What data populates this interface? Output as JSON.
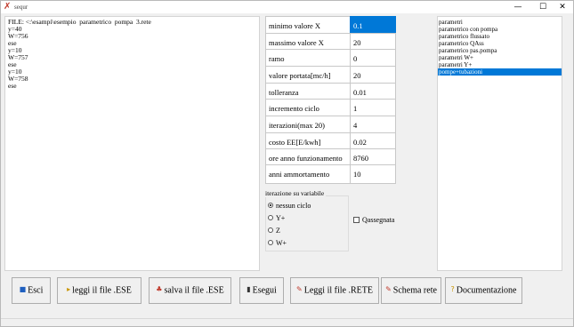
{
  "window": {
    "title": "sequr",
    "minimize_glyph": "—",
    "maximize_glyph": "☐",
    "close_glyph": "✕"
  },
  "output": {
    "lines": [
      "FILE: <:\\esampi\\esempio  parametrico  pompa  3.rete",
      "y=40",
      "W=756",
      "ese",
      "y=10",
      "W=757",
      "ese",
      "y=10",
      "W=758",
      "ese"
    ]
  },
  "params": [
    {
      "label": "minimo valore X",
      "value": "0.1",
      "selected": true
    },
    {
      "label": "massimo valore X",
      "value": "20",
      "selected": false
    },
    {
      "label": "ramo",
      "value": "0",
      "selected": false
    },
    {
      "label": "valore portata[mc/h]",
      "value": "20",
      "selected": false
    },
    {
      "label": "tolleranza",
      "value": "0.01",
      "selected": false
    },
    {
      "label": "incremento ciclo",
      "value": "1",
      "selected": false
    },
    {
      "label": "iterazioni(max 20)",
      "value": "4",
      "selected": false
    },
    {
      "label": "costo EE[E/kwh]",
      "value": "0.02",
      "selected": false
    },
    {
      "label": "ore anno funzionamento",
      "value": "8760",
      "selected": false
    },
    {
      "label": "anni ammortamento",
      "value": "10",
      "selected": false
    }
  ],
  "iteration_group": {
    "legend": "iterazione su variabile",
    "options": [
      {
        "label": "nessun ciclo",
        "checked": true
      },
      {
        "label": "Y+",
        "checked": false
      },
      {
        "label": "Z",
        "checked": false
      },
      {
        "label": "W+",
        "checked": false
      }
    ]
  },
  "checkbox": {
    "label": "Qassegnata",
    "checked": false
  },
  "list": {
    "items": [
      {
        "label": "parametri",
        "selected": false
      },
      {
        "label": "parametrico con pompa",
        "selected": false
      },
      {
        "label": "parametrico flussato",
        "selected": false
      },
      {
        "label": "parametrico QAss",
        "selected": false
      },
      {
        "label": "parametrico pas.pompa",
        "selected": false
      },
      {
        "label": "parametri W+",
        "selected": false
      },
      {
        "label": "parametri Y+",
        "selected": false
      },
      {
        "label": "pompe+tubazioni",
        "selected": true
      }
    ]
  },
  "buttons": {
    "exit": {
      "label": "Esci",
      "icon": "exit-icon",
      "glyph": "■"
    },
    "read_ese": {
      "label": "leggi il file .ESE",
      "icon": "open-file-icon",
      "glyph": "▸"
    },
    "save_ese": {
      "label": "salva il file .ESE",
      "icon": "save-file-icon",
      "glyph": "♣"
    },
    "run": {
      "label": "Esegui",
      "icon": "run-icon",
      "glyph": "▮"
    },
    "read_rete": {
      "label": "Leggi il file .RETE",
      "icon": "read-network-icon",
      "glyph": "✎"
    },
    "schema": {
      "label": "Schema rete",
      "icon": "network-schema-icon",
      "glyph": "✎"
    },
    "docs": {
      "label": "Documentazione",
      "icon": "help-icon",
      "glyph": "?"
    }
  },
  "colors": {
    "selection": "#0078d7",
    "window_bg": "#f0f0f0"
  }
}
